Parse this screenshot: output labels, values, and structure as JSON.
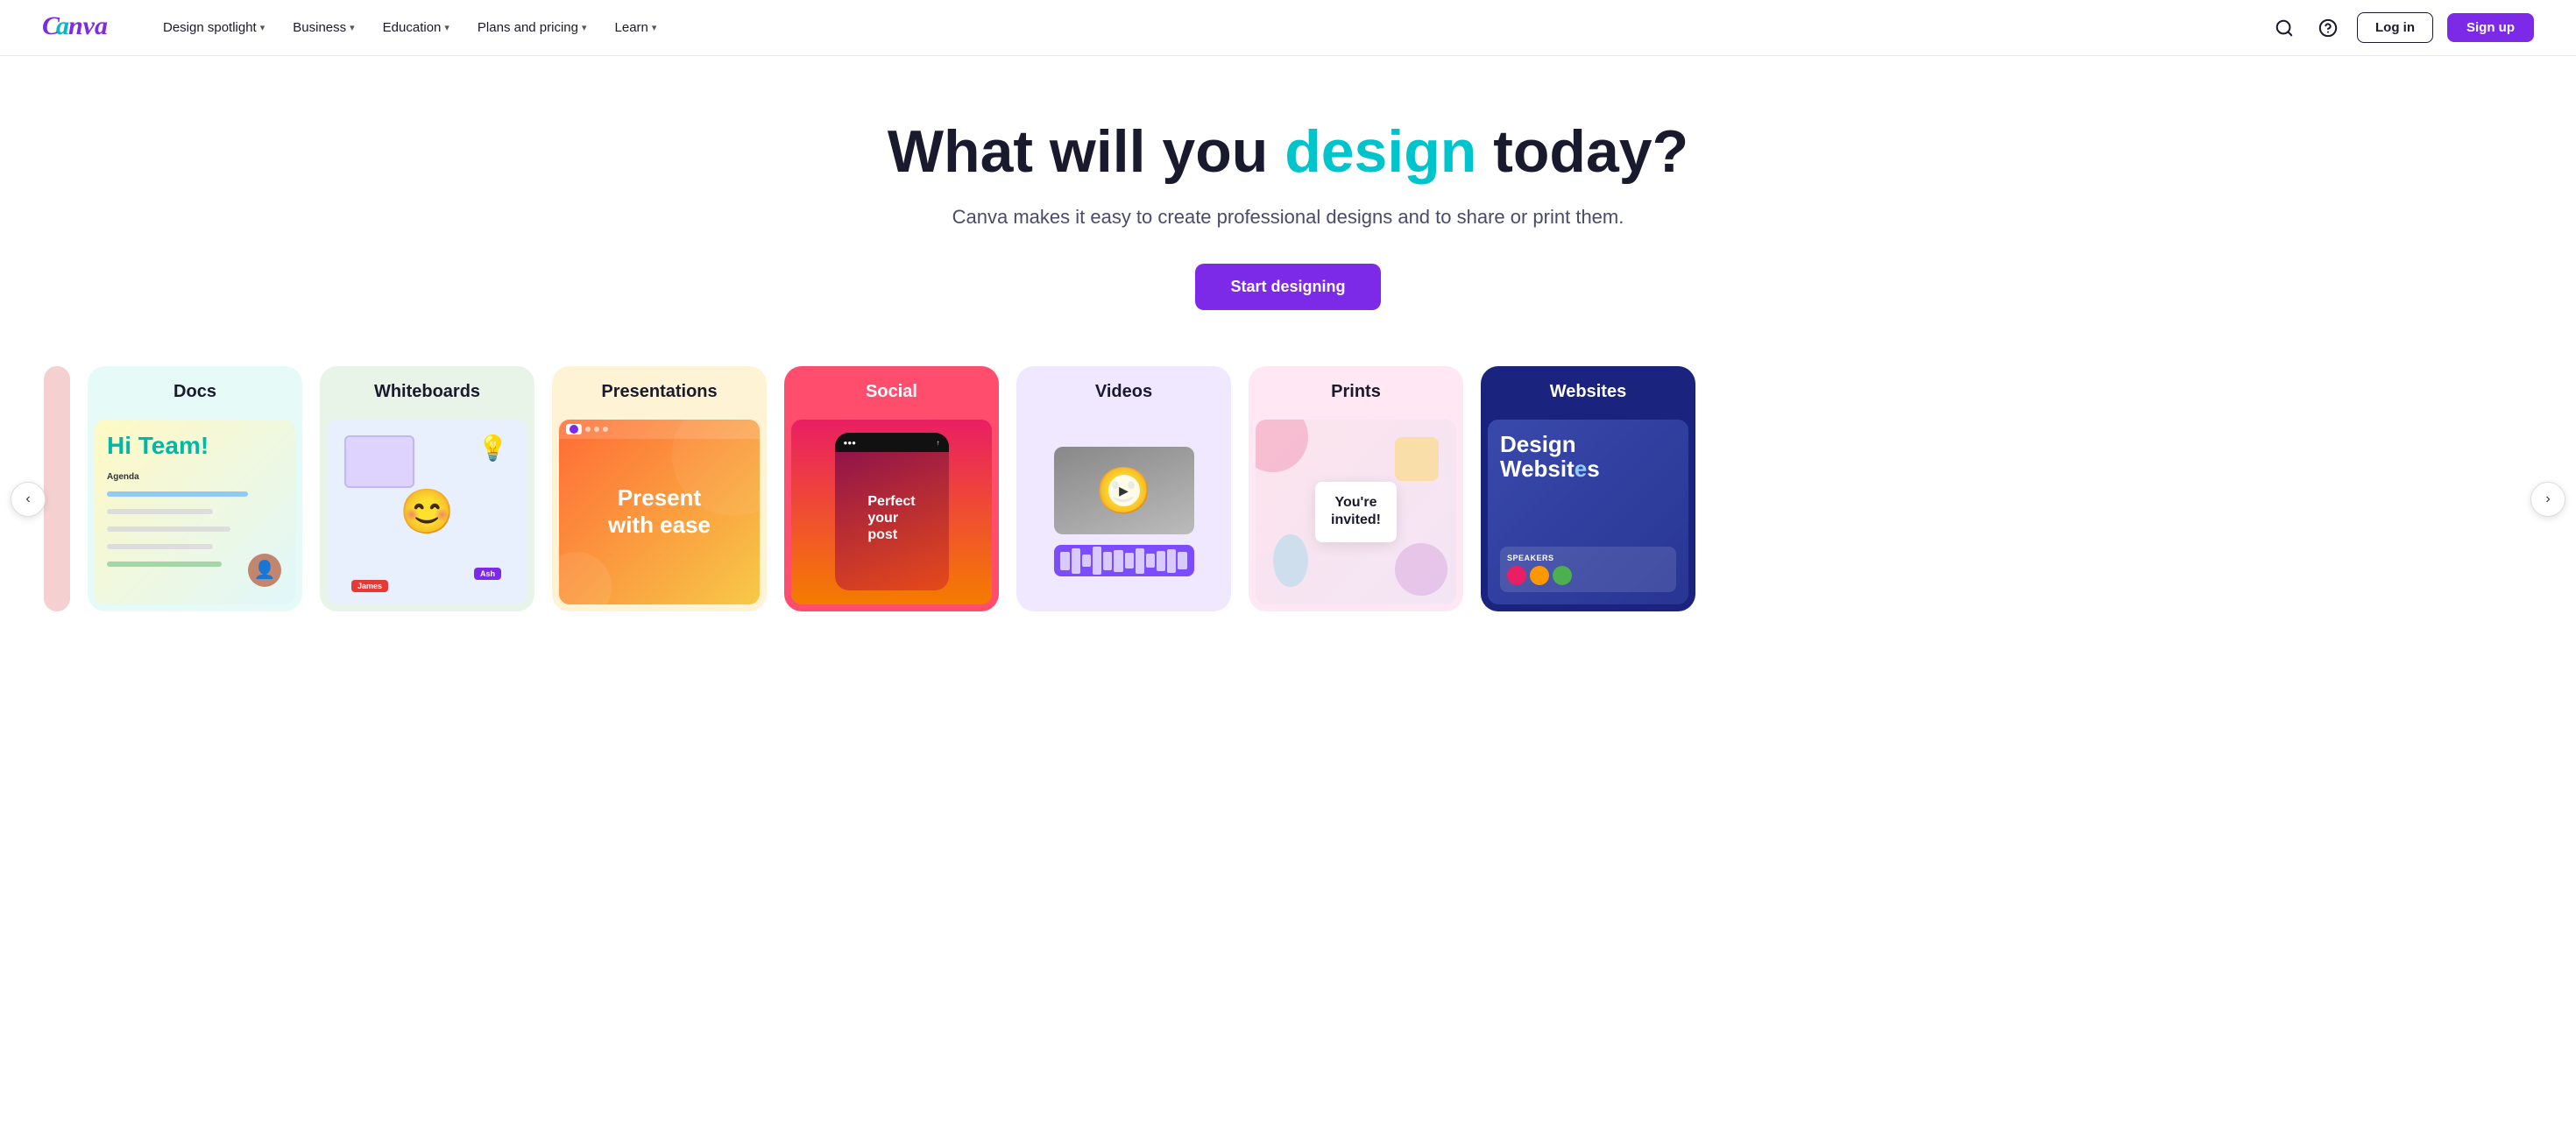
{
  "nav": {
    "logo": "Canva",
    "links": [
      {
        "label": "Design spotlight",
        "id": "design-spotlight"
      },
      {
        "label": "Business",
        "id": "business"
      },
      {
        "label": "Education",
        "id": "education"
      },
      {
        "label": "Plans and pricing",
        "id": "plans-pricing"
      },
      {
        "label": "Learn",
        "id": "learn"
      }
    ],
    "login_label": "Log in",
    "signup_label": "Sign up"
  },
  "hero": {
    "title_start": "What will you ",
    "title_highlight": "design",
    "title_end": " today?",
    "subtitle": "Canva makes it easy to create professional designs and to share or print them.",
    "cta_label": "Start designing"
  },
  "cards": [
    {
      "id": "docs",
      "title": "Docs",
      "bg": "#e6faf8",
      "title_color": "#1a1a2e",
      "preview_type": "docs",
      "hi_text": "Hi Team!",
      "agenda_label": "Agenda"
    },
    {
      "id": "whiteboards",
      "title": "Whiteboards",
      "bg": "#e8f4e8",
      "title_color": "#1a1a2e",
      "preview_type": "whiteboards"
    },
    {
      "id": "presentations",
      "title": "Presentations",
      "bg": "#fff3d6",
      "title_color": "#1a1a2e",
      "preview_type": "presentations",
      "present_text": "Present with ease"
    },
    {
      "id": "social",
      "title": "Social",
      "bg": "#ff4d6d",
      "title_color": "#ffffff",
      "preview_type": "social",
      "social_text": "Perfect your post"
    },
    {
      "id": "videos",
      "title": "Videos",
      "bg": "#f0e8ff",
      "title_color": "#1a1a2e",
      "preview_type": "videos"
    },
    {
      "id": "prints",
      "title": "Prints",
      "bg": "#ffe8f4",
      "title_color": "#1a1a2e",
      "preview_type": "prints",
      "invite_line1": "You're",
      "invite_line2": "invited!"
    },
    {
      "id": "websites",
      "title": "Websites",
      "bg": "#1a237e",
      "title_color": "#ffffff",
      "preview_type": "websites",
      "web_text": "Design Websites",
      "speakers_label": "SPEAKERS"
    }
  ],
  "arrow": {
    "prev": "‹",
    "next": "›"
  }
}
